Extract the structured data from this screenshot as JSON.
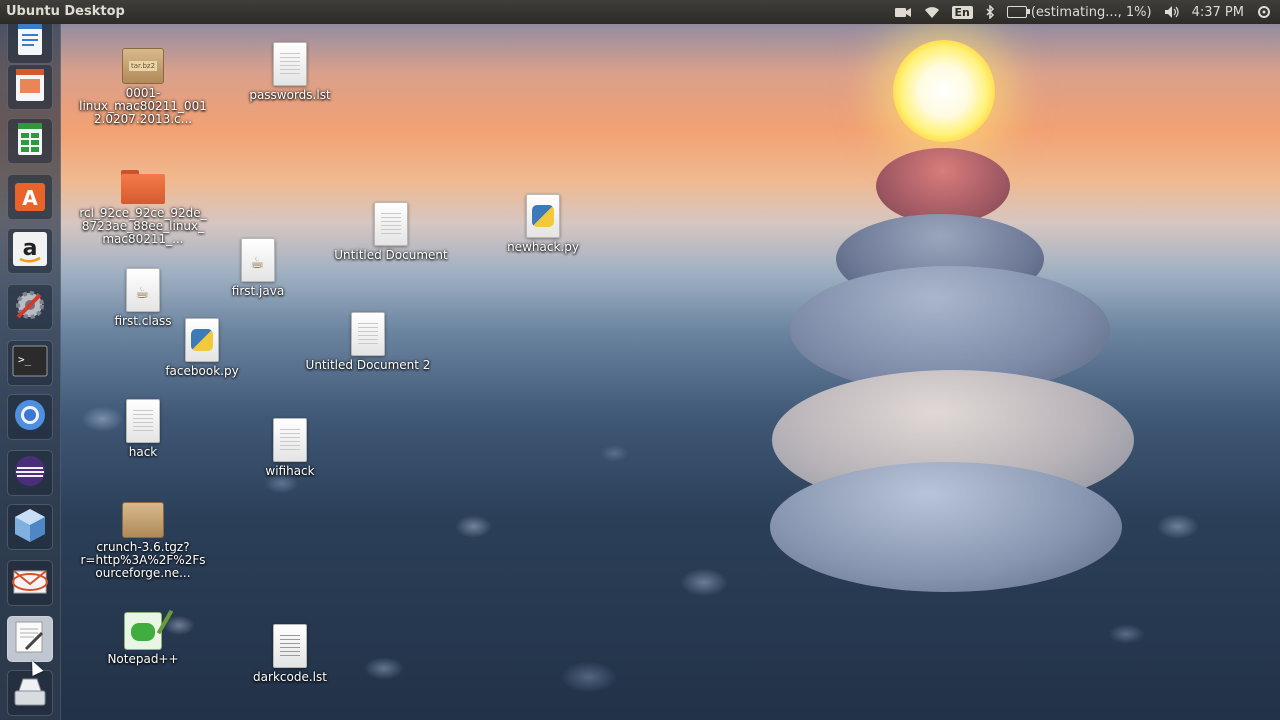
{
  "top_panel": {
    "title": "Ubuntu Desktop",
    "battery_text": "(estimating..., 1%)",
    "keyboard_layout": "En",
    "clock": "4:37 PM",
    "indicator_icons": [
      "camera-icon",
      "wifi-icon",
      "keyboard-icon",
      "bluetooth-icon",
      "battery-icon",
      "volume-icon",
      "power-gear-icon"
    ]
  },
  "launcher": {
    "items": [
      {
        "name": "libreoffice-writer",
        "icon": "writer-icon"
      },
      {
        "name": "libreoffice-impress",
        "icon": "impress-icon"
      },
      {
        "name": "libreoffice-calc",
        "icon": "calc-icon"
      },
      {
        "name": "ubuntu-software-center",
        "icon": "software-center-icon"
      },
      {
        "name": "amazon",
        "icon": "amazon-icon"
      },
      {
        "name": "system-settings",
        "icon": "settings-icon"
      },
      {
        "name": "terminal",
        "icon": "terminal-icon"
      },
      {
        "name": "chromium",
        "icon": "chromium-icon"
      },
      {
        "name": "eclipse",
        "icon": "eclipse-icon"
      },
      {
        "name": "virtualbox",
        "icon": "virtualbox-icon"
      },
      {
        "name": "mail",
        "icon": "mail-icon"
      },
      {
        "name": "text-editor",
        "icon": "text-editor-icon"
      },
      {
        "name": "drive",
        "icon": "drive-icon"
      }
    ]
  },
  "desktop_icons": [
    {
      "label": "0001-linux_mac80211_0012.0207.2013.c...",
      "kind": "archive",
      "archive_tag": "tar.bz2"
    },
    {
      "label": "passwords.lst",
      "kind": "document"
    },
    {
      "label": "rcl_92ce_92ce_92de_8723ae_88ee_linux_mac80211_...",
      "kind": "folder"
    },
    {
      "label": "Untitled Document",
      "kind": "document"
    },
    {
      "label": "newhack.py",
      "kind": "python"
    },
    {
      "label": "first.java",
      "kind": "java"
    },
    {
      "label": "first.class",
      "kind": "java"
    },
    {
      "label": "facebook.py",
      "kind": "python"
    },
    {
      "label": "Untitled Document 2",
      "kind": "document"
    },
    {
      "label": "hack",
      "kind": "document"
    },
    {
      "label": "wifihack",
      "kind": "document"
    },
    {
      "label": "crunch-3.6.tgz?r=http%3A%2F%2Fsourceforge.ne...",
      "kind": "archive",
      "archive_tag": ""
    },
    {
      "label": "Notepad++",
      "kind": "application"
    },
    {
      "label": "darkcode.lst",
      "kind": "document"
    }
  ]
}
